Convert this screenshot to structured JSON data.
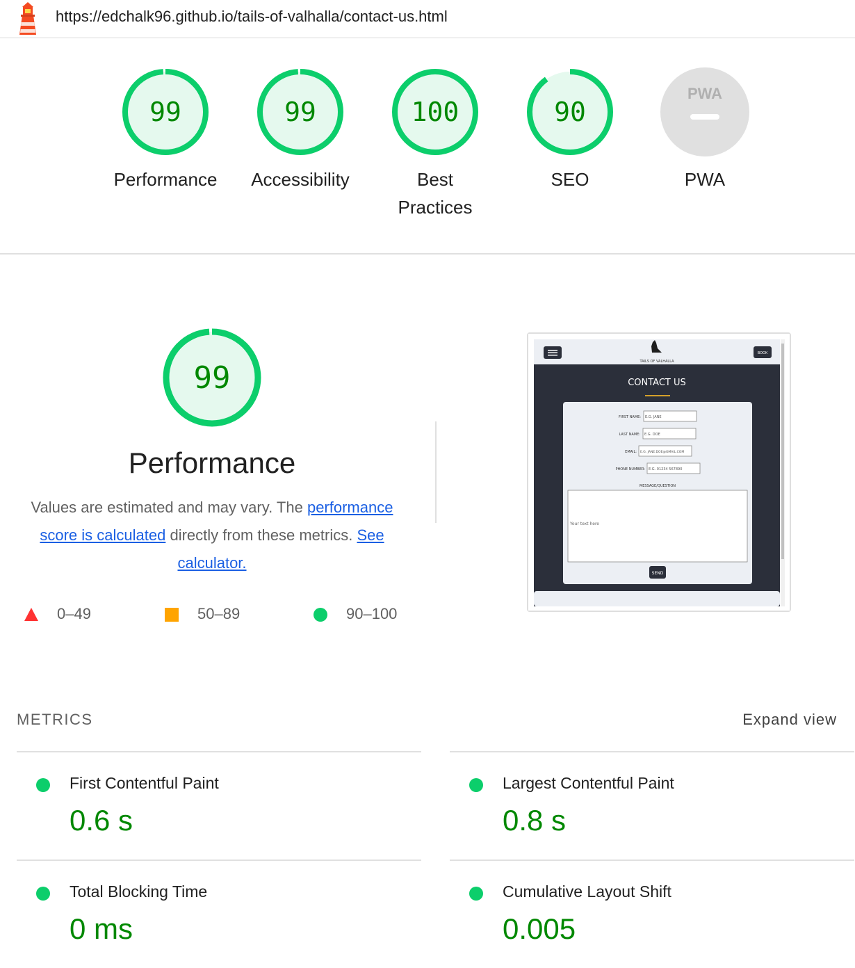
{
  "header": {
    "url": "https://edchalk96.github.io/tails-of-valhalla/contact-us.html",
    "logo_icon": "lighthouse-icon"
  },
  "gauges": [
    {
      "score": "99",
      "label": "Performance",
      "fill": 0.99
    },
    {
      "score": "99",
      "label": "Accessibility",
      "fill": 0.99
    },
    {
      "score": "100",
      "label": "Best Practices",
      "fill": 1.0
    },
    {
      "score": "90",
      "label": "SEO",
      "fill": 0.9
    },
    {
      "score": "PWA",
      "label": "PWA",
      "fill": 0
    }
  ],
  "performance": {
    "score": "99",
    "fill": 0.99,
    "title": "Performance",
    "desc_1": "Values are estimated and may vary. The",
    "link_1": "performance score is calculated",
    "desc_2": "directly from these metrics.",
    "link_2": "See calculator."
  },
  "legend": [
    {
      "range": "0–49",
      "icon": "red-triangle-icon"
    },
    {
      "range": "50–89",
      "icon": "orange-square-icon"
    },
    {
      "range": "90–100",
      "icon": "green-circle-icon"
    }
  ],
  "screenshot": {
    "book_button": "BOOK",
    "brand": "TAILS OF VALHALLA",
    "heading": "CONTACT US",
    "fields": [
      {
        "label": "FIRST NAME:",
        "placeholder": "E.G. JANE"
      },
      {
        "label": "LAST NAME:",
        "placeholder": "E.G. DOE"
      },
      {
        "label": "EMAIL:",
        "placeholder": "E.G. JANE.DOE@GMAIL.COM"
      },
      {
        "label": "PHONE NUMBER:",
        "placeholder": "E.G. 01234 567890"
      }
    ],
    "message_label": "MESSAGE/QUESTION",
    "message_placeholder": "Your text here",
    "send_button": "SEND"
  },
  "metrics": {
    "heading": "METRICS",
    "expand": "Expand view",
    "items": [
      {
        "label": "First Contentful Paint",
        "value": "0.6 s"
      },
      {
        "label": "Largest Contentful Paint",
        "value": "0.8 s"
      },
      {
        "label": "Total Blocking Time",
        "value": "0 ms"
      },
      {
        "label": "Cumulative Layout Shift",
        "value": "0.005"
      }
    ]
  },
  "colors": {
    "pass_green": "#0cce6b",
    "pass_text": "#008800",
    "pass_bg": "#e5f9ee",
    "average_orange": "#ffa400",
    "fail_red": "#ff3333",
    "link_blue": "#1a5fe3",
    "screenshot_dark": "#2b2f3a"
  }
}
